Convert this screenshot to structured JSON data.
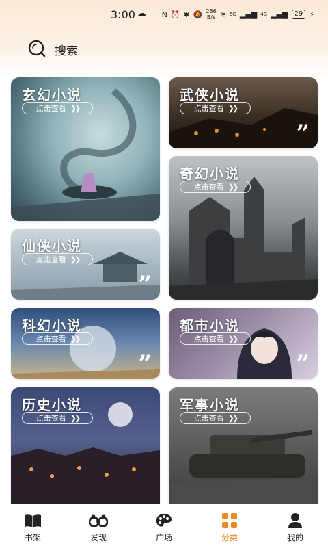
{
  "status": {
    "time": "3:00",
    "net_speed_top": "286",
    "net_speed_bottom": "B/s",
    "sig_5g": "5G",
    "sig_4g": "4G",
    "battery": "29"
  },
  "search": {
    "label": "搜索"
  },
  "categories": [
    {
      "title": "玄幻小说",
      "button": "点击查看"
    },
    {
      "title": "武侠小说",
      "button": "点击查看"
    },
    {
      "title": "奇幻小说",
      "button": "点击查看"
    },
    {
      "title": "仙侠小说",
      "button": "点击查看"
    },
    {
      "title": "科幻小说",
      "button": "点击查看"
    },
    {
      "title": "都市小说",
      "button": "点击查看"
    },
    {
      "title": "历史小说",
      "button": "点击查看"
    },
    {
      "title": "军事小说",
      "button": "点击查看"
    }
  ],
  "nav": [
    {
      "label": "书架",
      "icon": "book-icon"
    },
    {
      "label": "发现",
      "icon": "binoculars-icon"
    },
    {
      "label": "广场",
      "icon": "palette-icon"
    },
    {
      "label": "分类",
      "icon": "grid-icon",
      "active": true
    },
    {
      "label": "我的",
      "icon": "person-icon"
    }
  ],
  "colors": {
    "accent": "#f08a24"
  }
}
